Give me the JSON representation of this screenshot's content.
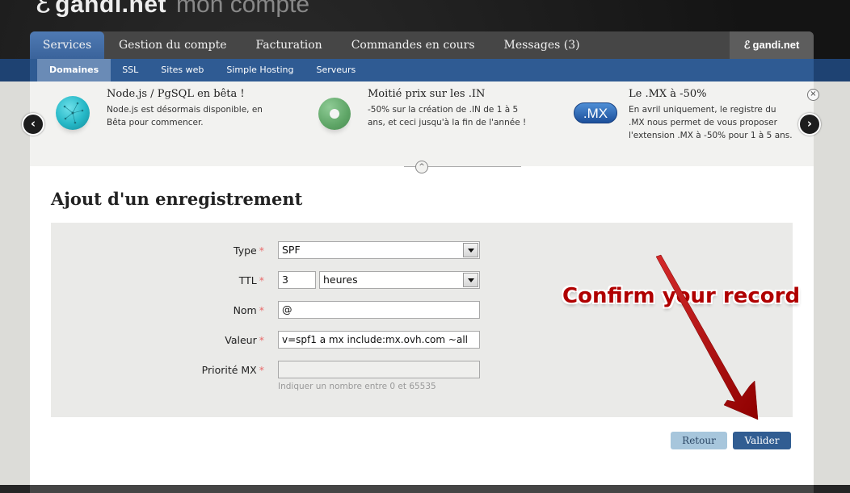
{
  "header": {
    "logo_glyph": "ℰ",
    "brand": "gandi.net",
    "subtitle": "mon compte"
  },
  "main_nav": {
    "tabs": [
      {
        "label": "Services",
        "active": true
      },
      {
        "label": "Gestion du compte",
        "active": false
      },
      {
        "label": "Facturation",
        "active": false
      },
      {
        "label": "Commandes en cours",
        "active": false
      },
      {
        "label": "Messages (3)",
        "active": false
      }
    ],
    "brand_tab": {
      "glyph": "ℰ",
      "label": "gandi.net"
    }
  },
  "sub_nav": {
    "items": [
      {
        "label": "Domaines",
        "active": true
      },
      {
        "label": "SSL",
        "active": false
      },
      {
        "label": "Sites web",
        "active": false
      },
      {
        "label": "Simple Hosting",
        "active": false
      },
      {
        "label": "Serveurs",
        "active": false
      }
    ]
  },
  "promos": [
    {
      "icon": "nodejs-globe-icon",
      "title": "Node.js / PgSQL en bêta !",
      "text": "Node.js est désormais disponible, en Bêta pour commencer."
    },
    {
      "icon": "green-ring-icon",
      "title": "Moitié prix sur les .IN",
      "text": "-50% sur la création de .IN de 1 à 5 ans, et ceci jusqu'à la fin de l'année !"
    },
    {
      "icon": "mx-badge-icon",
      "icon_text": ".MX",
      "title": "Le .MX à -50%",
      "text": "En avril uniquement, le registre du .MX nous permet de vous proposer l'extension .MX à -50% pour 1 à 5 ans."
    }
  ],
  "promo_controls": {
    "prev_glyph": "‹",
    "next_glyph": "›",
    "close_glyph": "×",
    "collapse_glyph": "^"
  },
  "page": {
    "title": "Ajout d'un enregistrement"
  },
  "form": {
    "required_mark": "*",
    "type": {
      "label": "Type",
      "value": "SPF"
    },
    "ttl": {
      "label": "TTL",
      "value": "3",
      "unit": "heures"
    },
    "nom": {
      "label": "Nom",
      "value": "@"
    },
    "valeur": {
      "label": "Valeur",
      "value": "v=spf1 a mx include:mx.ovh.com ~all"
    },
    "priorite_mx": {
      "label": "Priorité MX",
      "value": "",
      "hint": "Indiquer un nombre entre 0 et 65535"
    }
  },
  "annotation": {
    "text": "Confirm your record",
    "color": "#b00000"
  },
  "buttons": {
    "back": "Retour",
    "submit": "Valider"
  },
  "colors": {
    "accent_blue": "#315d92",
    "nav_dark": "#464646",
    "required": "#e96a6a"
  }
}
